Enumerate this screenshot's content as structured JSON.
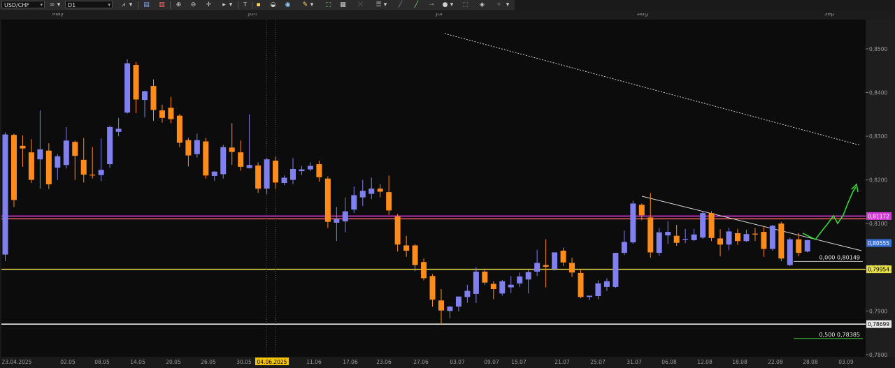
{
  "toolbar": {
    "symbol": "USD/CHF",
    "timeframe": "D1",
    "icons": [
      "instrument-dropdown-icon",
      "link-icon",
      "timeframe-dropdown-icon",
      "chart-type-icon",
      "indicator-icon",
      "oscillator-icon",
      "zoom-in-icon",
      "zoom-out-icon",
      "crosshair-icon",
      "pointer-icon",
      "text-icon",
      "cursor-icon",
      "note-icon",
      "paint-icon",
      "pencil-icon",
      "share-icon",
      "screenshot-icon",
      "fibonacci-icon",
      "channel-icon",
      "line-icon",
      "shape-icon",
      "settings-icon",
      "delete-icon",
      "more-icon"
    ]
  },
  "chart_data": {
    "type": "candlestick",
    "symbol": "USD/CHF",
    "timeframe": "D1",
    "month_labels": [
      "May",
      "Jun",
      "Jul",
      "Aug",
      "Sep"
    ],
    "date_labels": [
      "23.04.2025",
      "02.05",
      "08.05",
      "14.05",
      "20.05",
      "26.05",
      "30.05",
      "04.06.2025",
      "11.06",
      "17.06",
      "23.06",
      "27.06",
      "03.07",
      "09.07",
      "15.07",
      "21.07",
      "25.07",
      "31.07",
      "06.08",
      "12.08",
      "18.08",
      "22.08",
      "28.08",
      "03.09"
    ],
    "highlighted_date": "04.06.2025",
    "y_ticks": [
      "0,8500",
      "0,8400",
      "0,8300",
      "0,8200",
      "0,8100",
      "0,8000",
      "0,7900",
      "0,7800"
    ],
    "ylim": [
      0.7795,
      0.8567
    ],
    "price_badges": [
      {
        "label": "0,81172",
        "value": 0.81172,
        "color": "#d63ad6"
      },
      {
        "label": "0,80555",
        "value": 0.80555,
        "color": "#3a6fd6"
      },
      {
        "label": "0,79954",
        "value": 0.79954,
        "color": "#e8e24a"
      },
      {
        "label": "0,78699",
        "value": 0.78699,
        "color": "#e8e8e8"
      }
    ],
    "fib_labels": [
      {
        "label": "0,000  0,80149",
        "value": 0.80149
      },
      {
        "label": "0,500  0,78385",
        "value": 0.78385
      }
    ],
    "horizontal_lines": [
      {
        "value": 0.81172,
        "color": "#d63ad6"
      },
      {
        "value": 0.8111,
        "color": "#e05a5a"
      },
      {
        "value": 0.79954,
        "color": "#e8e24a"
      },
      {
        "value": 0.78699,
        "color": "#e8e8e8"
      }
    ],
    "series": [
      {
        "date": "23.04",
        "o": 0.8029,
        "h": 0.8309,
        "l": 0.8014,
        "c": 0.8304
      },
      {
        "date": "24.04",
        "o": 0.8303,
        "h": 0.8306,
        "l": 0.8138,
        "c": 0.8154
      },
      {
        "date": "25.04",
        "o": 0.8278,
        "h": 0.8302,
        "l": 0.823,
        "c": 0.8272
      },
      {
        "date": "28.04",
        "o": 0.8263,
        "h": 0.8293,
        "l": 0.8193,
        "c": 0.82
      },
      {
        "date": "29.04",
        "o": 0.8247,
        "h": 0.8359,
        "l": 0.818,
        "c": 0.827
      },
      {
        "date": "30.04",
        "o": 0.8267,
        "h": 0.8284,
        "l": 0.8179,
        "c": 0.819
      },
      {
        "date": "01.05",
        "o": 0.8228,
        "h": 0.8259,
        "l": 0.82,
        "c": 0.8254
      },
      {
        "date": "02.05",
        "o": 0.8234,
        "h": 0.8321,
        "l": 0.8226,
        "c": 0.829
      },
      {
        "date": "05.05",
        "o": 0.8287,
        "h": 0.829,
        "l": 0.82,
        "c": 0.8255
      },
      {
        "date": "06.05",
        "o": 0.8246,
        "h": 0.8296,
        "l": 0.8194,
        "c": 0.8212
      },
      {
        "date": "07.05",
        "o": 0.8212,
        "h": 0.8275,
        "l": 0.8203,
        "c": 0.821
      },
      {
        "date": "08.05",
        "o": 0.8211,
        "h": 0.8295,
        "l": 0.8197,
        "c": 0.8223
      },
      {
        "date": "09.05",
        "o": 0.8236,
        "h": 0.8324,
        "l": 0.8228,
        "c": 0.8321
      },
      {
        "date": "12.05",
        "o": 0.831,
        "h": 0.8342,
        "l": 0.83,
        "c": 0.8317
      },
      {
        "date": "13.05",
        "o": 0.8354,
        "h": 0.8476,
        "l": 0.8352,
        "c": 0.8467
      },
      {
        "date": "14.05",
        "o": 0.8463,
        "h": 0.847,
        "l": 0.8353,
        "c": 0.8384
      },
      {
        "date": "15.05",
        "o": 0.8383,
        "h": 0.8404,
        "l": 0.8343,
        "c": 0.8403
      },
      {
        "date": "16.05",
        "o": 0.8415,
        "h": 0.843,
        "l": 0.8335,
        "c": 0.836
      },
      {
        "date": "19.05",
        "o": 0.8359,
        "h": 0.8372,
        "l": 0.8331,
        "c": 0.8342
      },
      {
        "date": "20.05",
        "o": 0.8365,
        "h": 0.839,
        "l": 0.833,
        "c": 0.8339
      },
      {
        "date": "21.05",
        "o": 0.8347,
        "h": 0.8351,
        "l": 0.8275,
        "c": 0.8285
      },
      {
        "date": "22.05",
        "o": 0.8291,
        "h": 0.8296,
        "l": 0.8231,
        "c": 0.8256
      },
      {
        "date": "23.05",
        "o": 0.8259,
        "h": 0.8306,
        "l": 0.8251,
        "c": 0.8291
      },
      {
        "date": "26.05",
        "o": 0.8288,
        "h": 0.8296,
        "l": 0.8203,
        "c": 0.821
      },
      {
        "date": "27.05",
        "o": 0.8209,
        "h": 0.822,
        "l": 0.8198,
        "c": 0.8219
      },
      {
        "date": "28.05",
        "o": 0.8213,
        "h": 0.828,
        "l": 0.8203,
        "c": 0.8275
      },
      {
        "date": "29.05",
        "o": 0.8274,
        "h": 0.833,
        "l": 0.8234,
        "c": 0.8264
      },
      {
        "date": "30.05",
        "o": 0.8263,
        "h": 0.829,
        "l": 0.8221,
        "c": 0.823
      },
      {
        "date": "02.06",
        "o": 0.8227,
        "h": 0.835,
        "l": 0.8226,
        "c": 0.8234
      },
      {
        "date": "03.06",
        "o": 0.8233,
        "h": 0.824,
        "l": 0.817,
        "c": 0.818
      },
      {
        "date": "04.06",
        "o": 0.818,
        "h": 0.825,
        "l": 0.8167,
        "c": 0.8247
      },
      {
        "date": "05.06",
        "o": 0.8244,
        "h": 0.8253,
        "l": 0.818,
        "c": 0.8194
      },
      {
        "date": "06.06",
        "o": 0.8193,
        "h": 0.821,
        "l": 0.8188,
        "c": 0.8205
      },
      {
        "date": "09.06",
        "o": 0.82,
        "h": 0.825,
        "l": 0.819,
        "c": 0.8225
      },
      {
        "date": "10.06",
        "o": 0.822,
        "h": 0.8232,
        "l": 0.8211,
        "c": 0.8224
      },
      {
        "date": "11.06",
        "o": 0.8224,
        "h": 0.824,
        "l": 0.822,
        "c": 0.8232
      },
      {
        "date": "12.06",
        "o": 0.8236,
        "h": 0.8244,
        "l": 0.8196,
        "c": 0.8206
      },
      {
        "date": "13.06",
        "o": 0.8203,
        "h": 0.8208,
        "l": 0.809,
        "c": 0.8104
      },
      {
        "date": "16.06",
        "o": 0.8102,
        "h": 0.8138,
        "l": 0.806,
        "c": 0.8111
      },
      {
        "date": "17.06",
        "o": 0.8105,
        "h": 0.816,
        "l": 0.808,
        "c": 0.8128
      },
      {
        "date": "18.06",
        "o": 0.8132,
        "h": 0.8185,
        "l": 0.8124,
        "c": 0.8165
      },
      {
        "date": "19.06",
        "o": 0.816,
        "h": 0.82,
        "l": 0.814,
        "c": 0.8175
      },
      {
        "date": "20.06",
        "o": 0.8168,
        "h": 0.8205,
        "l": 0.8156,
        "c": 0.818
      },
      {
        "date": "23.06",
        "o": 0.818,
        "h": 0.819,
        "l": 0.816,
        "c": 0.8173
      },
      {
        "date": "24.06",
        "o": 0.8172,
        "h": 0.821,
        "l": 0.812,
        "c": 0.813
      },
      {
        "date": "25.06",
        "o": 0.8116,
        "h": 0.8122,
        "l": 0.8036,
        "c": 0.8052
      },
      {
        "date": "26.06",
        "o": 0.805,
        "h": 0.8072,
        "l": 0.8024,
        "c": 0.8038
      },
      {
        "date": "27.06",
        "o": 0.805,
        "h": 0.8053,
        "l": 0.7991,
        "c": 0.8005
      },
      {
        "date": "30.06",
        "o": 0.8012,
        "h": 0.802,
        "l": 0.797,
        "c": 0.7975
      },
      {
        "date": "01.07",
        "o": 0.798,
        "h": 0.7984,
        "l": 0.791,
        "c": 0.7926
      },
      {
        "date": "02.07",
        "o": 0.7924,
        "h": 0.795,
        "l": 0.7868,
        "c": 0.7901
      },
      {
        "date": "03.07",
        "o": 0.79,
        "h": 0.7912,
        "l": 0.7883,
        "c": 0.791
      },
      {
        "date": "04.07",
        "o": 0.791,
        "h": 0.7928,
        "l": 0.7899,
        "c": 0.7933
      },
      {
        "date": "07.07",
        "o": 0.7932,
        "h": 0.796,
        "l": 0.7919,
        "c": 0.7946
      },
      {
        "date": "08.07",
        "o": 0.7939,
        "h": 0.8,
        "l": 0.7918,
        "c": 0.799
      },
      {
        "date": "09.07",
        "o": 0.799,
        "h": 0.7996,
        "l": 0.796,
        "c": 0.7965
      },
      {
        "date": "10.07",
        "o": 0.7962,
        "h": 0.7968,
        "l": 0.7927,
        "c": 0.795
      },
      {
        "date": "11.07",
        "o": 0.794,
        "h": 0.7971,
        "l": 0.7935,
        "c": 0.7968
      },
      {
        "date": "14.07",
        "o": 0.7954,
        "h": 0.798,
        "l": 0.7941,
        "c": 0.796
      },
      {
        "date": "15.07",
        "o": 0.7963,
        "h": 0.7988,
        "l": 0.7955,
        "c": 0.7979
      },
      {
        "date": "16.07",
        "o": 0.7972,
        "h": 0.7995,
        "l": 0.794,
        "c": 0.7989
      },
      {
        "date": "17.07",
        "o": 0.799,
        "h": 0.804,
        "l": 0.798,
        "c": 0.801
      },
      {
        "date": "18.07",
        "o": 0.8005,
        "h": 0.8064,
        "l": 0.7954,
        "c": 0.8001
      },
      {
        "date": "21.07",
        "o": 0.7996,
        "h": 0.8032,
        "l": 0.7992,
        "c": 0.8034
      },
      {
        "date": "22.07",
        "o": 0.8038,
        "h": 0.8045,
        "l": 0.8003,
        "c": 0.8011
      },
      {
        "date": "23.07",
        "o": 0.801,
        "h": 0.8022,
        "l": 0.7978,
        "c": 0.7988
      },
      {
        "date": "24.07",
        "o": 0.7987,
        "h": 0.7996,
        "l": 0.7929,
        "c": 0.7932
      },
      {
        "date": "25.07",
        "o": 0.7932,
        "h": 0.7935,
        "l": 0.7925,
        "c": 0.7935
      },
      {
        "date": "28.07",
        "o": 0.7934,
        "h": 0.797,
        "l": 0.7927,
        "c": 0.7963
      },
      {
        "date": "29.07",
        "o": 0.7955,
        "h": 0.7975,
        "l": 0.7946,
        "c": 0.7968
      },
      {
        "date": "30.07",
        "o": 0.7955,
        "h": 0.8033,
        "l": 0.7953,
        "c": 0.8033
      },
      {
        "date": "31.07",
        "o": 0.8033,
        "h": 0.8084,
        "l": 0.8028,
        "c": 0.8058
      },
      {
        "date": "01.08",
        "o": 0.8057,
        "h": 0.8152,
        "l": 0.8054,
        "c": 0.8146
      },
      {
        "date": "04.08",
        "o": 0.8143,
        "h": 0.8146,
        "l": 0.8108,
        "c": 0.8119
      },
      {
        "date": "05.08",
        "o": 0.8114,
        "h": 0.817,
        "l": 0.8022,
        "c": 0.8034
      },
      {
        "date": "06.08",
        "o": 0.8033,
        "h": 0.809,
        "l": 0.8026,
        "c": 0.808
      },
      {
        "date": "07.08",
        "o": 0.8073,
        "h": 0.8105,
        "l": 0.8053,
        "c": 0.8081
      },
      {
        "date": "08.08",
        "o": 0.8072,
        "h": 0.8097,
        "l": 0.8049,
        "c": 0.8056
      },
      {
        "date": "11.08",
        "o": 0.8063,
        "h": 0.8088,
        "l": 0.8055,
        "c": 0.8065
      },
      {
        "date": "12.08",
        "o": 0.8062,
        "h": 0.8088,
        "l": 0.806,
        "c": 0.8075
      },
      {
        "date": "13.08",
        "o": 0.8068,
        "h": 0.8128,
        "l": 0.8065,
        "c": 0.8124
      },
      {
        "date": "14.08",
        "o": 0.8124,
        "h": 0.8128,
        "l": 0.806,
        "c": 0.8067
      },
      {
        "date": "15.08",
        "o": 0.8066,
        "h": 0.8087,
        "l": 0.8025,
        "c": 0.8052
      },
      {
        "date": "18.08",
        "o": 0.8052,
        "h": 0.809,
        "l": 0.8039,
        "c": 0.8082
      },
      {
        "date": "19.08",
        "o": 0.8078,
        "h": 0.8088,
        "l": 0.8051,
        "c": 0.806
      },
      {
        "date": "20.08",
        "o": 0.806,
        "h": 0.8086,
        "l": 0.8058,
        "c": 0.8076
      },
      {
        "date": "21.08",
        "o": 0.8077,
        "h": 0.809,
        "l": 0.806,
        "c": 0.8075
      },
      {
        "date": "22.08",
        "o": 0.8081,
        "h": 0.8092,
        "l": 0.8024,
        "c": 0.8042
      },
      {
        "date": "25.08",
        "o": 0.8042,
        "h": 0.8097,
        "l": 0.8038,
        "c": 0.8095
      },
      {
        "date": "26.08",
        "o": 0.81,
        "h": 0.8104,
        "l": 0.8014,
        "c": 0.802
      },
      {
        "date": "27.08",
        "o": 0.8005,
        "h": 0.8068,
        "l": 0.8003,
        "c": 0.8064
      },
      {
        "date": "28.08",
        "o": 0.8064,
        "h": 0.8078,
        "l": 0.8025,
        "c": 0.8033
      },
      {
        "date": "29.08",
        "o": 0.8036,
        "h": 0.8063,
        "l": 0.8034,
        "c": 0.8062
      }
    ],
    "colors": {
      "up": "#8080ee",
      "down": "#ff8c1a",
      "background": "#0c0c0c"
    }
  }
}
